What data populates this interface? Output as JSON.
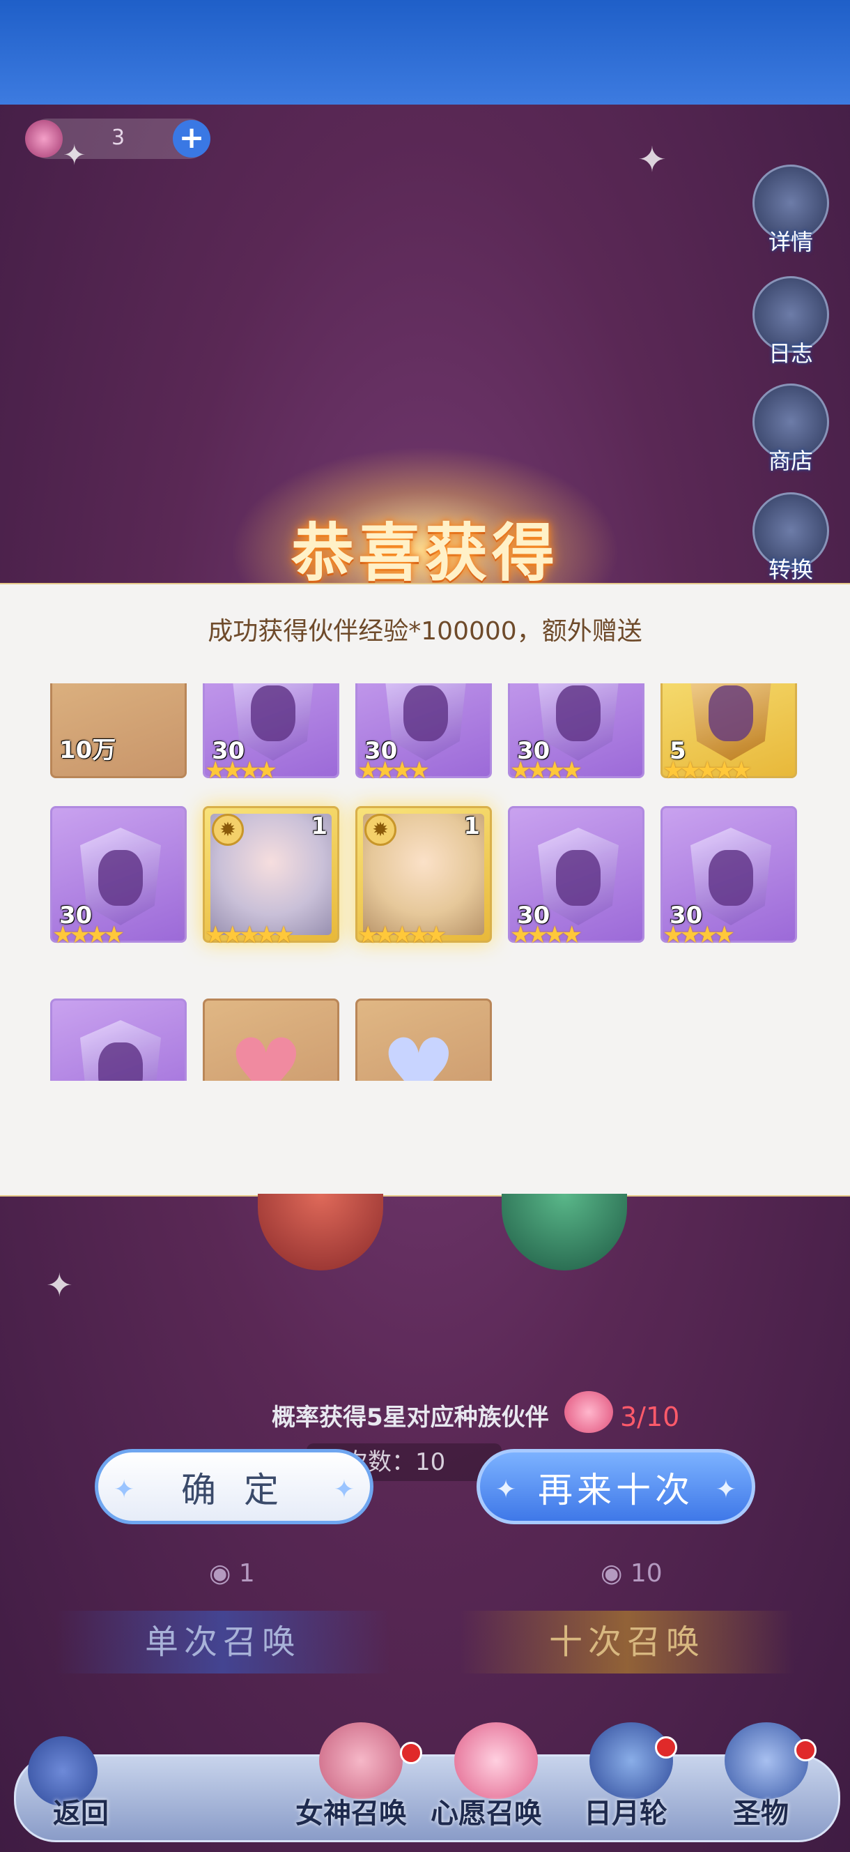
{
  "currency": {
    "value": "3"
  },
  "side_menu": [
    {
      "label": "详情",
      "icon": "magnifier-icon"
    },
    {
      "label": "日志",
      "icon": "book-icon"
    },
    {
      "label": "商店",
      "icon": "shop-icon"
    },
    {
      "label": "转换",
      "icon": "exchange-icon"
    }
  ],
  "reward": {
    "title": "恭喜获得",
    "message": "成功获得伙伴经验*100000，额外赠送",
    "row1": [
      {
        "type": "item",
        "count": "10万",
        "stars": 0,
        "icon": "exp-pack-icon"
      },
      {
        "type": "purple",
        "count": "30",
        "stars": 4
      },
      {
        "type": "purple",
        "count": "30",
        "stars": 4
      },
      {
        "type": "purple",
        "count": "30",
        "stars": 4
      },
      {
        "type": "gold",
        "count": "5",
        "stars": 5
      }
    ],
    "row2": [
      {
        "type": "purple",
        "count": "30",
        "stars": 4
      },
      {
        "type": "hero",
        "count": "1",
        "stars": 5,
        "icon": "silver-hair-girl-portrait"
      },
      {
        "type": "hero",
        "count": "1",
        "stars": 5,
        "icon": "blonde-girl-portrait"
      },
      {
        "type": "purple",
        "count": "30",
        "stars": 4
      },
      {
        "type": "purple",
        "count": "30",
        "stars": 4
      }
    ],
    "row3": [
      {
        "type": "purple",
        "icon": "purple-crystal-icon"
      },
      {
        "type": "brown",
        "icon": "pink-heart-icon"
      },
      {
        "type": "brown",
        "icon": "crystal-heart-icon"
      }
    ]
  },
  "pity": {
    "text": "概率获得5星对应种族伙伴",
    "progress": "3/10",
    "count_label": "唤次数：10"
  },
  "buttons": {
    "confirm": "确 定",
    "again": "再来十次"
  },
  "summon": {
    "single": {
      "label": "单次召唤",
      "cost": "1"
    },
    "ten": {
      "label": "十次召唤",
      "cost": "10"
    }
  },
  "nav": {
    "back": "返回",
    "items": [
      "女神召唤",
      "心愿召唤",
      "日月轮",
      "圣物"
    ]
  },
  "colors": {
    "panel": "#f4f3f2",
    "title_glow": "#ff9a2a",
    "accent_blue": "#3f78e8"
  }
}
